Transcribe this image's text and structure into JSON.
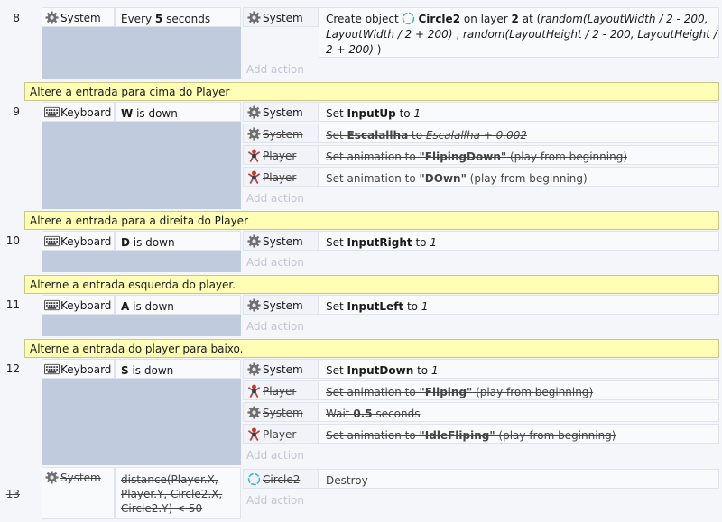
{
  "events": {
    "e8": {
      "number": "8",
      "cond_object": "System",
      "cond_pre": "Every ",
      "cond_bold": "5",
      "cond_post": " seconds",
      "actions": [
        {
          "object": "System",
          "pre": "Create object ",
          "bold": "Circle2",
          "mid": " on layer ",
          "bold2": "2",
          "post": " at (",
          "italic": "random(LayoutWidth / 2 - 200, LayoutWidth / 2 + 200)",
          "post2": " , ",
          "italic2": "random(LayoutHeight / 2 - 200, LayoutHeight / 2 + 200)",
          "end": " )"
        }
      ],
      "add_action": "Add action"
    },
    "c9": "Altere a entrada para cima do Player",
    "e9": {
      "number": "9",
      "cond_object": "Keyboard",
      "cond_bold": "W",
      "cond_post": " is down",
      "actions": [
        {
          "object": "System",
          "pre": "Set ",
          "bold": "InputUp",
          "post": " to ",
          "italic": "1"
        },
        {
          "object": "System",
          "pre": "Set ",
          "bold": "Escalallha",
          "post": " to ",
          "italic": "Escalallha + 0.002"
        },
        {
          "object": "Player",
          "pre": "Set animation to ",
          "bold": "\"FlipingDown\"",
          "post": " (play from beginning)"
        },
        {
          "object": "Player",
          "pre": "Set animation to ",
          "bold": "\"DOwn\"",
          "post": " (play from beginning)"
        }
      ],
      "add_action": "Add action"
    },
    "c10": "Altere a entrada para a direita do Player",
    "e10": {
      "number": "10",
      "cond_object": "Keyboard",
      "cond_bold": "D",
      "cond_post": " is down",
      "actions": [
        {
          "object": "System",
          "pre": "Set ",
          "bold": "InputRight",
          "post": " to ",
          "italic": "1"
        }
      ],
      "add_action": "Add action"
    },
    "c11": "Alterne a entrada esquerda do player.",
    "e11": {
      "number": "11",
      "cond_object": "Keyboard",
      "cond_bold": "A",
      "cond_post": " is down",
      "actions": [
        {
          "object": "System",
          "pre": "Set ",
          "bold": "InputLeft",
          "post": " to ",
          "italic": "1"
        }
      ],
      "add_action": "Add action"
    },
    "c12": "Alterne a entrada do player para baixo.",
    "e12": {
      "number": "12",
      "cond_object": "Keyboard",
      "cond_bold": "S",
      "cond_post": " is down",
      "actions": [
        {
          "object": "System",
          "pre": "Set ",
          "bold": "InputDown",
          "post": " to ",
          "italic": "1"
        },
        {
          "object": "Player",
          "pre": "Set animation to ",
          "bold": "\"Fliping\"",
          "post": " (play from beginning)"
        },
        {
          "object": "System",
          "pre": "Wait ",
          "bold": "0.5",
          "post": " seconds"
        },
        {
          "object": "Player",
          "pre": "Set animation to ",
          "bold": "\"IdleFliping\"",
          "post": " (play from beginning)"
        }
      ],
      "add_action": "Add action"
    },
    "e13": {
      "number": "13",
      "cond_object": "System",
      "cond_text": "distance(Player.X, Player.Y, Circle2.X, Circle2.Y) < 50",
      "actions": [
        {
          "object": "Circle2",
          "text": "Destroy"
        }
      ],
      "add_action": "Add action"
    }
  },
  "icons": {
    "system": "gear-icon",
    "keyboard": "keyboard-icon",
    "player": "player-sprite-icon",
    "circle": "circle-ring-icon"
  },
  "colors": {
    "comment_bg": "#fefeb4",
    "event_block_bg": "#c0cbdd",
    "circle_ring": "#3ab3d8"
  }
}
